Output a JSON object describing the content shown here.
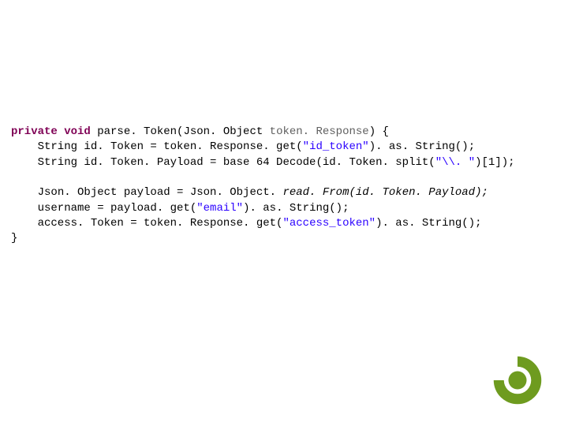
{
  "code": {
    "kw_private": "private",
    "kw_void": "void",
    "sig_method": " parse. Token(Json. Object ",
    "sig_param": "token. Response",
    "sig_close": ") {",
    "l1a": "    String id. Token = token. Response. get(",
    "l1s": "\"id_token\"",
    "l1b": "). as. String();",
    "l2a": "    String id. Token. Payload = base 64 Decode(id. Token. split(",
    "l2s": "\"\\\\. \"",
    "l2b": ")[1]);",
    "blank": " ",
    "l3a": "    ",
    "l3b": "Json. Object payload = Json. Object. ",
    "l3c": "read. From(id. Token. Payload);",
    "l4a": "    username = payload. get(",
    "l4s": "\"email\"",
    "l4b": "). as. String();",
    "l5a": "    access. Token = token. Response. get(",
    "l5s": "\"access_token\"",
    "l5b": "). as. String();",
    "end": "}"
  },
  "logo": {
    "outer_color": "#6e9b1f",
    "inner_color": "#ffffff"
  }
}
